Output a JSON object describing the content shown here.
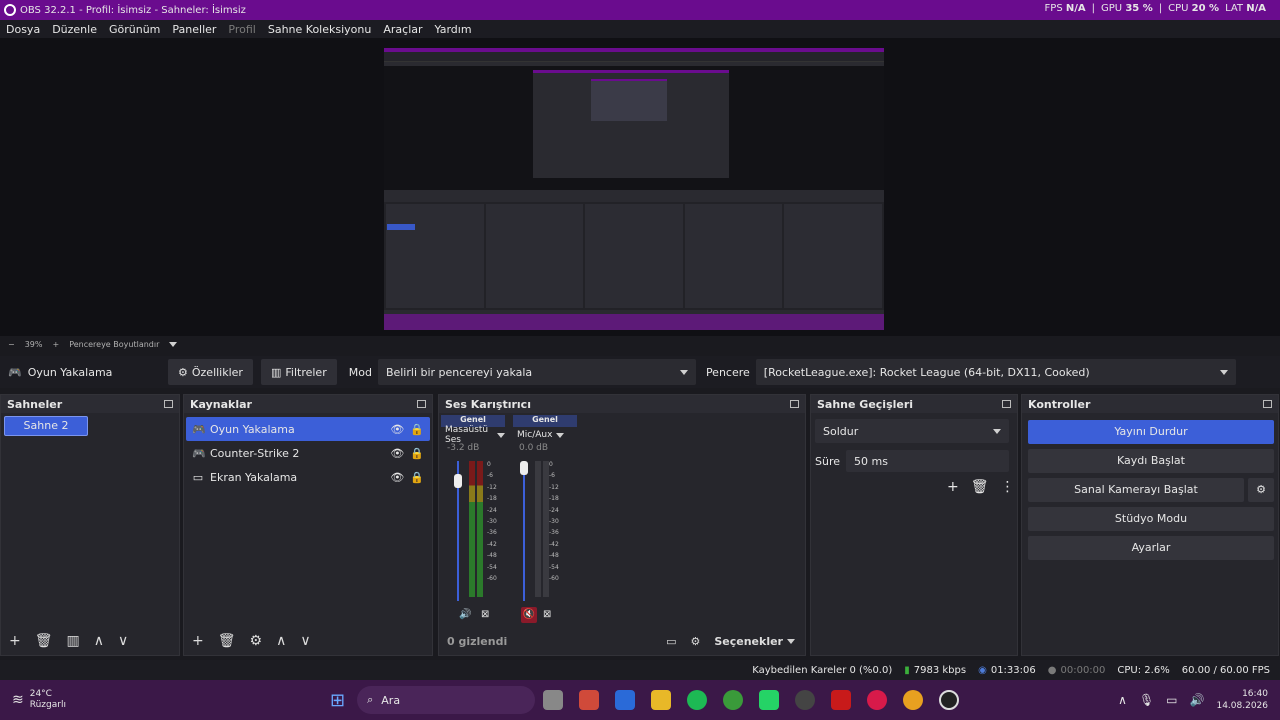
{
  "window": {
    "title": "OBS 32.2.1 - Profil: İsimsiz - Sahneler: İsimsiz"
  },
  "stats": {
    "fps_label": "FPS",
    "fps_value": "N/A",
    "gpu_label": "GPU",
    "gpu_value": "35 %",
    "cpu_label": "CPU",
    "cpu_value": "20 %",
    "lat_label": "LAT",
    "lat_value": "N/A"
  },
  "menu": [
    "Dosya",
    "Düzenle",
    "Görünüm",
    "Paneller",
    "Profil",
    "Sahne Koleksiyonu",
    "Araçlar",
    "Yardım"
  ],
  "zoom": {
    "minus": "−",
    "value": "39%",
    "plus": "+",
    "fit_label": "Pencereye Boyutlandır"
  },
  "sourcebar": {
    "source_name": "Oyun Yakalama",
    "properties": "Özellikler",
    "filters": "Filtreler",
    "mode_label": "Mod",
    "mode_value": "Belirli bir pencereyi yakala",
    "window_label": "Pencere",
    "window_value": "[RocketLeague.exe]: Rocket League (64-bit, DX11, Cooked)"
  },
  "scenes": {
    "title": "Sahneler",
    "items": [
      "Sahne 2"
    ]
  },
  "sources": {
    "title": "Kaynaklar",
    "items": [
      {
        "name": "Oyun Yakalama",
        "icon": "gamepad-icon"
      },
      {
        "name": "Counter-Strike 2",
        "icon": "gamepad-icon"
      },
      {
        "name": "Ekran Yakalama",
        "icon": "monitor-icon"
      }
    ]
  },
  "mixer": {
    "title": "Ses Karıştırıcı",
    "channels": [
      {
        "tag": "Genel",
        "name": "Masaüstü Ses",
        "db": "-3.2 dB",
        "fader_level": 0.9,
        "muted": false
      },
      {
        "tag": "Genel",
        "name": "Mic/Aux",
        "db": "0.0 dB",
        "fader_level": 1.0,
        "muted": true
      }
    ],
    "scale": [
      "0",
      "-6",
      "-12",
      "-18",
      "-24",
      "-30",
      "-36",
      "-42",
      "-48",
      "-54",
      "-60"
    ],
    "hidden_count": "0 gizlendi",
    "options": "Seçenekler"
  },
  "transitions": {
    "title": "Sahne Geçişleri",
    "value": "Soldur",
    "duration_label": "Süre",
    "duration_value": "50 ms"
  },
  "controls": {
    "title": "Kontroller",
    "stop_stream": "Yayını Durdur",
    "start_record": "Kaydı Başlat",
    "virtual_cam": "Sanal Kamerayı Başlat",
    "studio_mode": "Stüdyo Modu",
    "settings": "Ayarlar"
  },
  "status": {
    "dropped": "Kaybedilen Kareler 0 (%0.0)",
    "bitrate": "7983 kbps",
    "stream_time": "01:33:06",
    "record_time": "00:00:00",
    "cpu": "CPU: 2.6%",
    "fps": "60.00 / 60.00 FPS"
  },
  "taskbar": {
    "weather_temp": "24°C",
    "weather_desc": "Rüzgarlı",
    "search": "Ara",
    "time": "16:40",
    "date": "14.08.2026"
  }
}
